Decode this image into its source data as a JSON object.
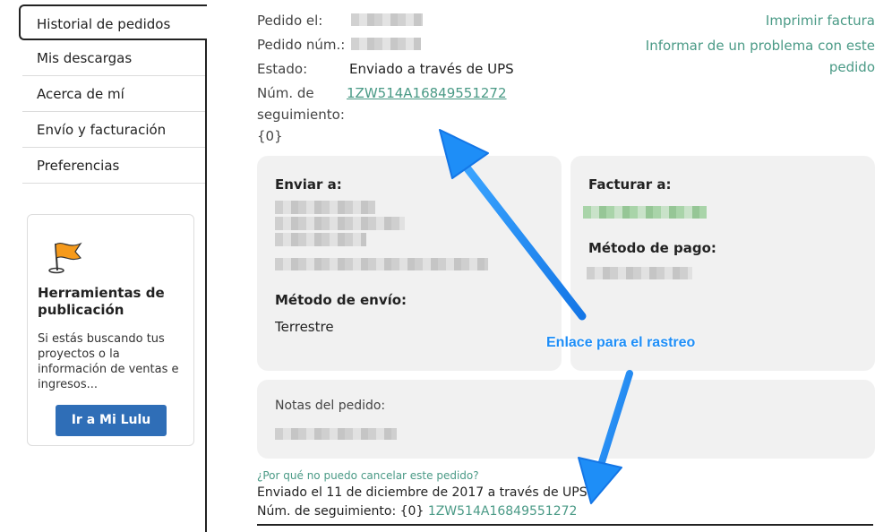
{
  "sidebar": {
    "items": [
      {
        "label": "Historial de pedidos",
        "active": true
      },
      {
        "label": "Mis descargas"
      },
      {
        "label": "Acerca de mí"
      },
      {
        "label": "Envío y facturación"
      },
      {
        "label": "Preferencias"
      }
    ],
    "promo": {
      "icon": "flag-icon",
      "title": "Herramientas de publicación",
      "text": "Si estás buscando tus proyectos o la información de ventas e ingresos...",
      "button": "Ir a Mi Lulu"
    }
  },
  "order": {
    "placed_label": "Pedido el:",
    "number_label": "Pedido núm.:",
    "status_label": "Estado:",
    "status_value": "Enviado a través de UPS",
    "tracking_label_line1": "Núm. de",
    "tracking_label_line2": "seguimiento:",
    "tracking_label_line3": "{0}",
    "tracking_number": "1ZW514A16849551272"
  },
  "actions": {
    "print_invoice": "Imprimir factura",
    "report_problem": "Informar de un problema con este pedido"
  },
  "ship_card": {
    "heading": "Enviar a:",
    "method_heading": "Método de envío:",
    "method_value": "Terrestre"
  },
  "bill_card": {
    "heading": "Facturar a:",
    "payment_heading": "Método de pago:"
  },
  "notes_card": {
    "heading": "Notas del pedido:"
  },
  "footer": {
    "cancel_link": "¿Por qué no puedo cancelar este pedido?",
    "shipped_text": "Enviado el 11 de diciembre de 2017 a través de UPS",
    "tracking_label": "Núm. de seguimiento: {0}",
    "tracking_number": "1ZW514A16849551272"
  },
  "annotation": {
    "text": "Enlace para el rastreo",
    "color": "#1e8ef7"
  },
  "colors": {
    "link": "#4a9a86",
    "button": "#2f6eb7",
    "card": "#f1f1f1"
  }
}
